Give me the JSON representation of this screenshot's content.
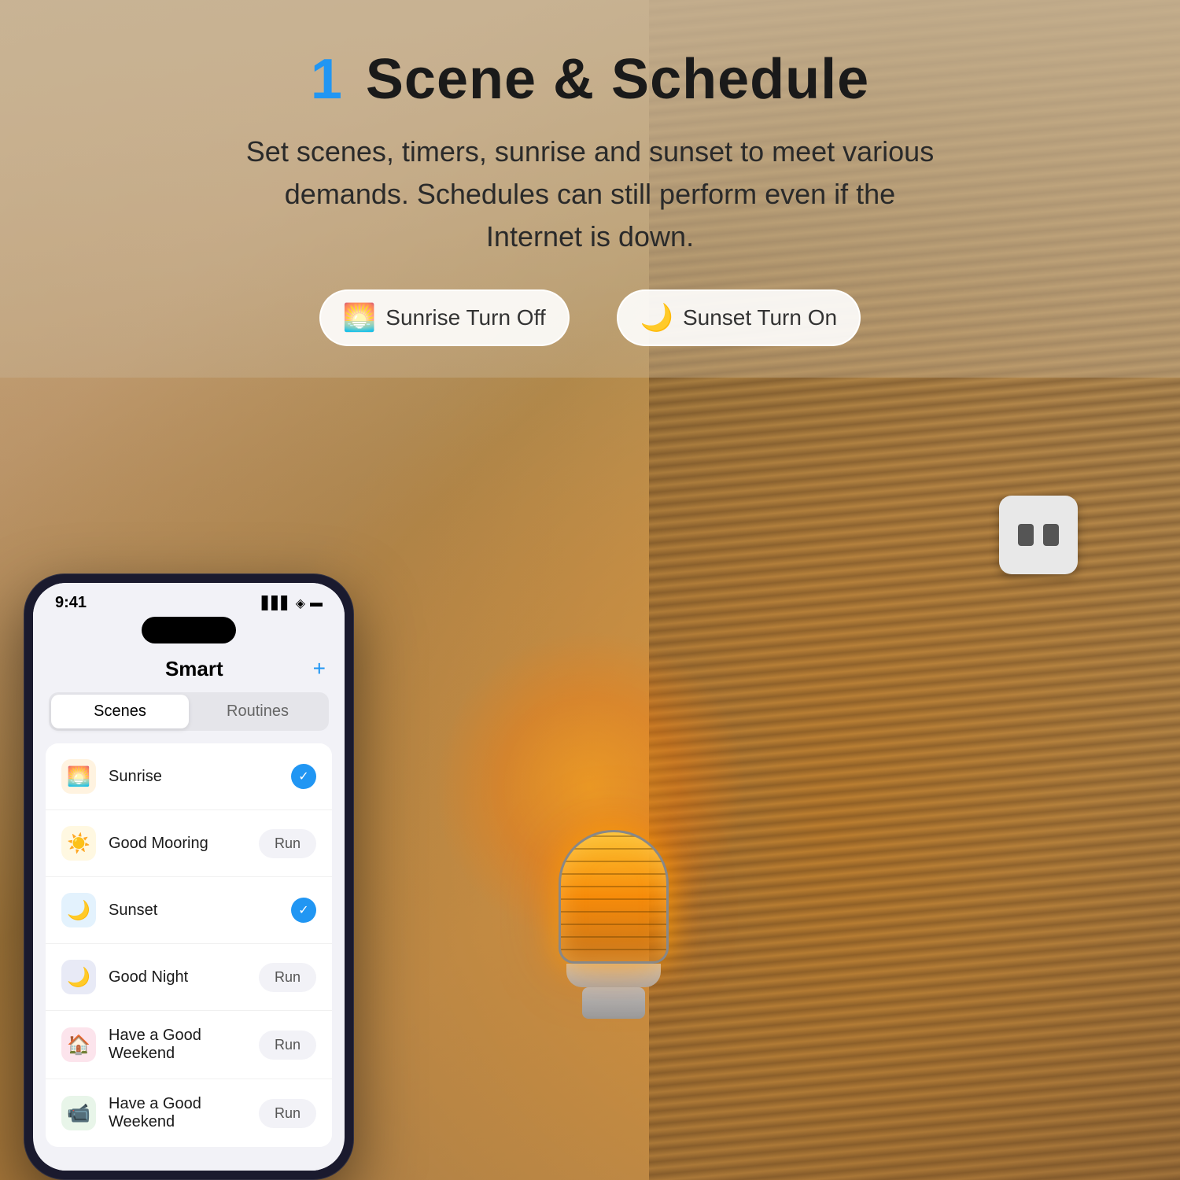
{
  "page": {
    "title": "Scene & Schedule",
    "title_number": "1",
    "subtitle": "Set scenes, timers, sunrise and sunset to meet various demands. Schedules can still perform even if the Internet is down."
  },
  "pills": [
    {
      "id": "sunrise-off",
      "icon": "🌅",
      "label": "Sunrise Turn Off"
    },
    {
      "id": "sunset-on",
      "icon": "🌙",
      "label": "Sunset Turn On"
    }
  ],
  "phone": {
    "status_time": "9:41",
    "app_title": "Smart",
    "add_button": "+",
    "tabs": [
      {
        "id": "scenes",
        "label": "Scenes",
        "active": true
      },
      {
        "id": "routines",
        "label": "Routines",
        "active": false
      }
    ],
    "scenes": [
      {
        "id": "sunrise",
        "name": "Sunrise",
        "icon": "🌅",
        "icon_type": "sunrise",
        "status": "check"
      },
      {
        "id": "good-mooring",
        "name": "Good Mooring",
        "icon": "☀️",
        "icon_type": "morning",
        "status": "run"
      },
      {
        "id": "sunset",
        "name": "Sunset",
        "icon": "🌙",
        "icon_type": "sunset",
        "status": "check"
      },
      {
        "id": "good-night",
        "name": "Good Night",
        "icon": "🌙",
        "icon_type": "night",
        "status": "run"
      },
      {
        "id": "good-weekend-1",
        "name": "Have a Good Weekend",
        "icon": "🏠",
        "icon_type": "weekend-red",
        "status": "run"
      },
      {
        "id": "good-weekend-2",
        "name": "Have a Good Weekend",
        "icon": "📹",
        "icon_type": "weekend-green",
        "status": "run"
      }
    ],
    "run_label": "Run"
  }
}
